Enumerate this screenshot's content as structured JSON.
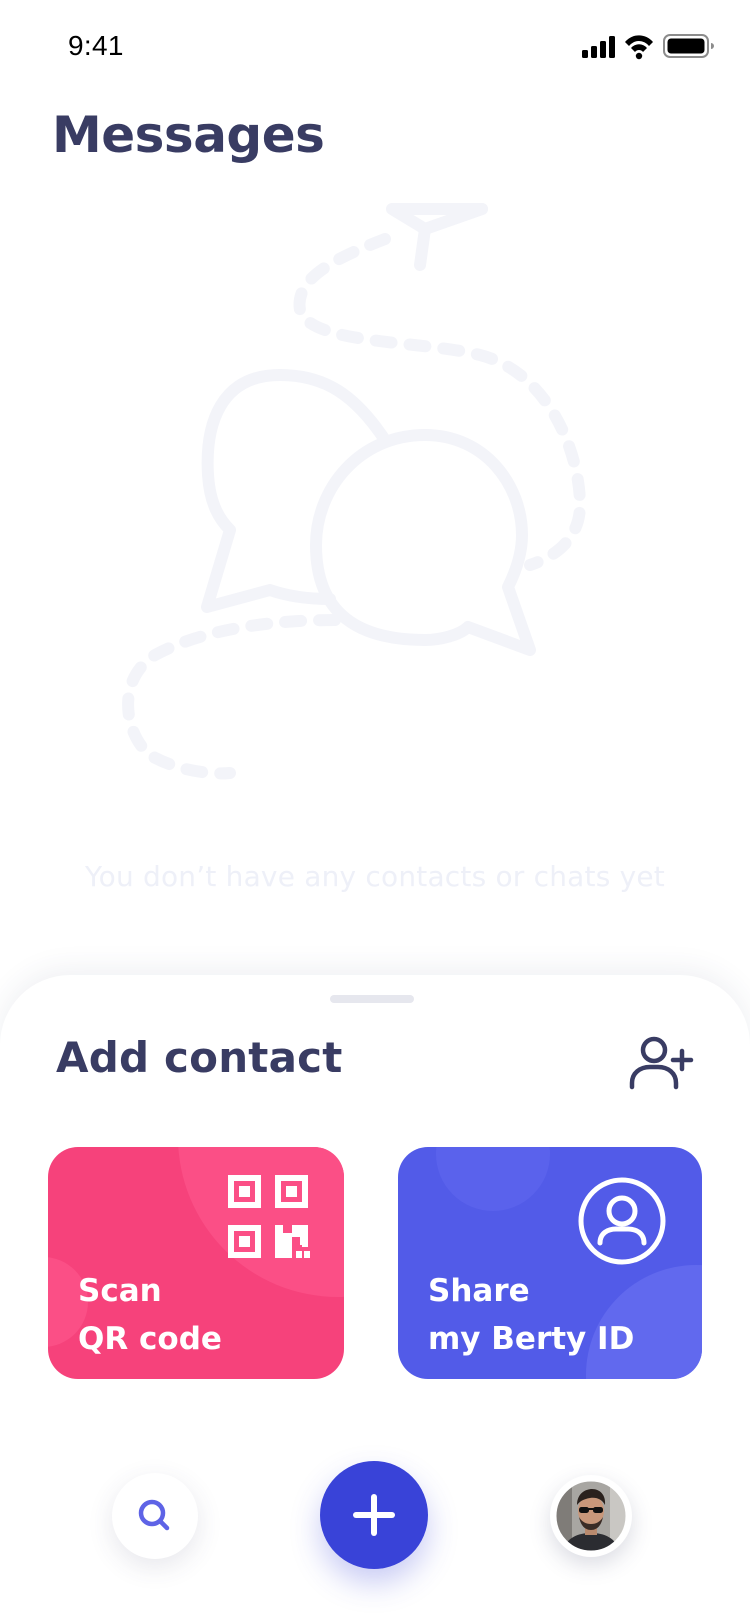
{
  "status_bar": {
    "time": "9:41"
  },
  "header": {
    "title": "Messages"
  },
  "empty_state": {
    "illustration_icon": "chat-bubbles-paper-plane-icon",
    "message": "You don’t have any contacts or chats yet"
  },
  "add_contact": {
    "title": "Add contact",
    "add_user_icon": "user-plus-icon",
    "cards": [
      {
        "label_line1": "Scan",
        "label_line2": "QR code",
        "icon": "qr-code-icon",
        "color": "#f6427b"
      },
      {
        "label_line1": "Share",
        "label_line2": "my Berty ID",
        "icon": "user-circle-icon",
        "color": "#525be8"
      }
    ]
  },
  "bottom_nav": {
    "search_icon": "search-icon",
    "add_icon": "plus-icon",
    "avatar": "profile-avatar",
    "accent": "#3943d8"
  },
  "colors": {
    "title": "#393c63",
    "empty_text": "#eef0f8",
    "illustration": "#f3f4f9"
  }
}
